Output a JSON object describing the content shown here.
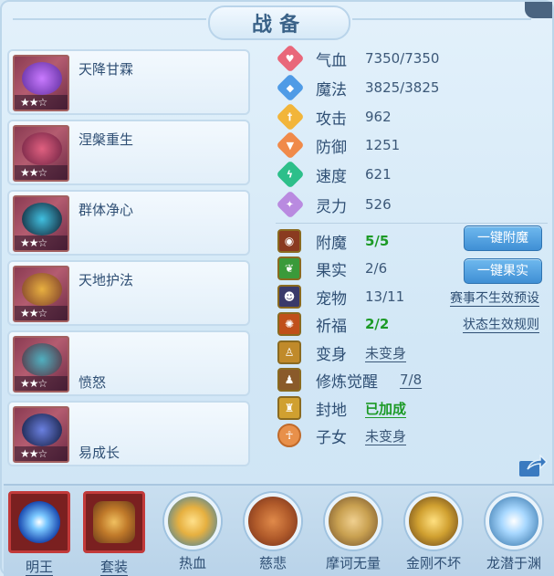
{
  "title": "战备",
  "cards": [
    {
      "name": "天降甘霖",
      "stars": "★★☆",
      "art_color": "#7a3ad0"
    },
    {
      "name": "涅槃重生",
      "stars": "★★☆",
      "art_color": "#9a3050"
    },
    {
      "name": "群体净心",
      "stars": "★★☆",
      "art_color": "#1a2040"
    },
    {
      "name": "天地护法",
      "stars": "★★☆",
      "art_color": "#c08a30"
    },
    {
      "name": "愤怒",
      "stars": "★★☆",
      "art_color": "#5a2a3a"
    },
    {
      "name": "易成长",
      "stars": "★★☆",
      "art_color": "#28307a"
    }
  ],
  "stats": [
    {
      "label": "气血",
      "value": "7350/7350",
      "color": "#e9677a",
      "glyph": "♥"
    },
    {
      "label": "魔法",
      "value": "3825/3825",
      "color": "#4f9be6",
      "glyph": "◆"
    },
    {
      "label": "攻击",
      "value": "962",
      "color": "#f2b53a",
      "glyph": "†"
    },
    {
      "label": "防御",
      "value": "1251",
      "color": "#f08a4a",
      "glyph": "▼"
    },
    {
      "label": "速度",
      "value": "621",
      "color": "#2dbf8a",
      "glyph": "ϟ"
    },
    {
      "label": "灵力",
      "value": "526",
      "color": "#b98ae0",
      "glyph": "✦"
    }
  ],
  "info": {
    "fumo": {
      "label": "附魔",
      "value": "5/5"
    },
    "guoshi": {
      "label": "果实",
      "value": "2/6"
    },
    "chongwu": {
      "label": "宠物",
      "value": "13/11"
    },
    "qifu": {
      "label": "祈福",
      "value": "2/2"
    },
    "bianshen": {
      "label": "变身",
      "value": "未变身"
    },
    "xiulian": {
      "label": "修炼觉醒",
      "value": "7/8"
    },
    "fengdi": {
      "label": "封地",
      "value": "已加成"
    },
    "zinv": {
      "label": "子女",
      "value": "未变身"
    }
  },
  "buttons": {
    "fumo": "一键附魔",
    "guoshi": "一键果实"
  },
  "links": {
    "saishi": "赛事不生效预设",
    "zhuangtai": "状态生效规则"
  },
  "bottom": [
    {
      "label": "明王",
      "shape": "square",
      "color": "#3aa0ff"
    },
    {
      "label": "套装",
      "shape": "square",
      "color": "#c07a3a"
    },
    {
      "label": "热血",
      "shape": "circle",
      "color": "#e6b040"
    },
    {
      "label": "慈悲",
      "shape": "circle",
      "color": "#b05a2a"
    },
    {
      "label": "摩诃无量",
      "shape": "circle",
      "color": "#c8a050"
    },
    {
      "label": "金刚不坏",
      "shape": "circle",
      "color": "#d0a030"
    },
    {
      "label": "龙潜于渊",
      "shape": "circle",
      "color": "#7ab8e6"
    }
  ]
}
